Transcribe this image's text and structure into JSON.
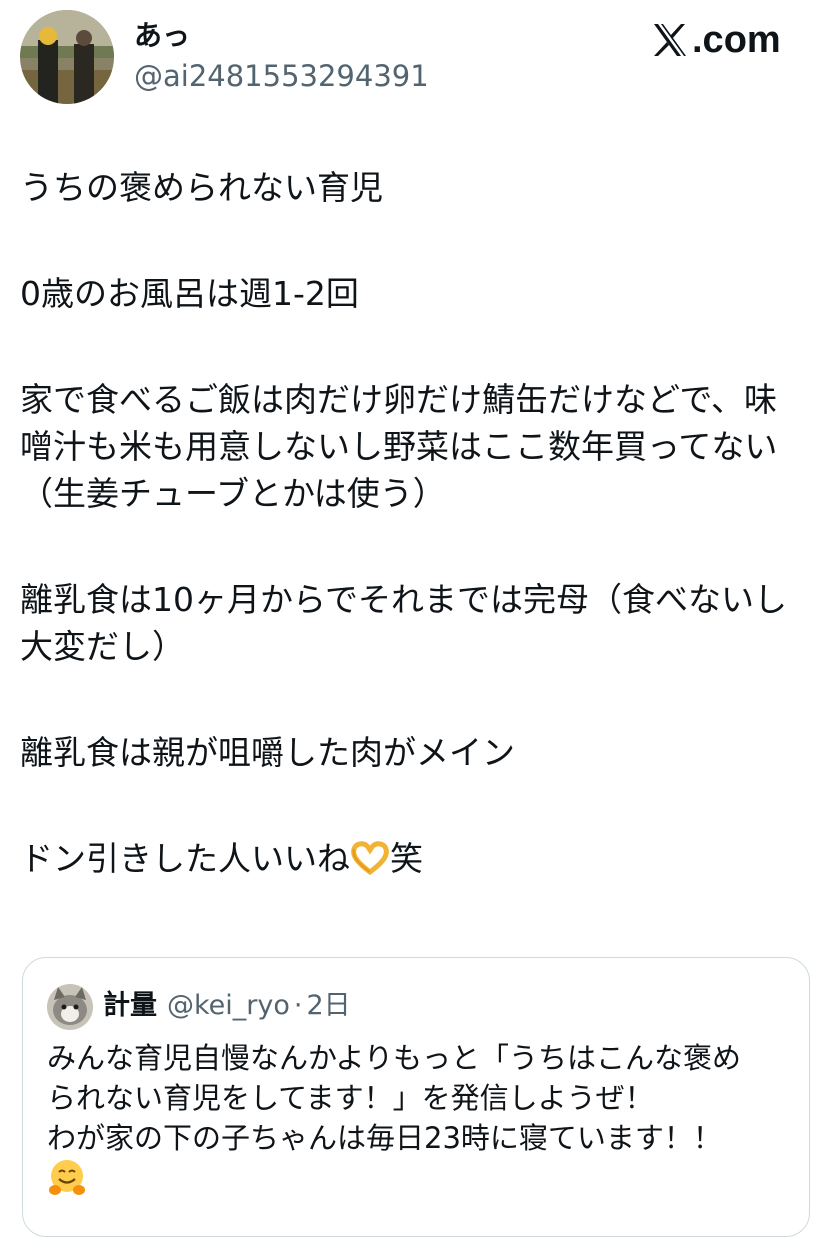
{
  "author": {
    "display_name": "あっ",
    "handle": "@ai2481553294391"
  },
  "brand": {
    "logo_text": "X.com",
    "suffix": ".com"
  },
  "tweet": {
    "lines": [
      "うちの褒められない育児",
      "0歳のお風呂は週1-2回",
      "家で食べるご飯は肉だけ卵だけ鯖缶だけなどで、味",
      "噌汁も米も用意しないし野菜はここ数年買ってない",
      "（生姜チューブとかは使う）",
      "離乳食は10ヶ月からでそれまでは完母（食べないし",
      "大変だし）",
      "離乳食は親が咀嚼した肉がメイン",
      "ドン引きした人いいね",
      "笑"
    ],
    "emoji": "heart-hands-emoji"
  },
  "quoted_tweet": {
    "display_name": "計量",
    "handle": "@kei_ryo",
    "separator": "·",
    "age": "2日",
    "lines": [
      "みんな育児自慢なんかよりもっと「うちはこんな褒め",
      "られない育児をしてます！」を発信しようぜ！",
      "わが家の下の子ちゃんは毎日23時に寝ています！！"
    ],
    "emoji": "hugging-face-emoji"
  },
  "colors": {
    "text": "#0f1419",
    "secondary": "#536471",
    "border": "#cfd9de"
  }
}
